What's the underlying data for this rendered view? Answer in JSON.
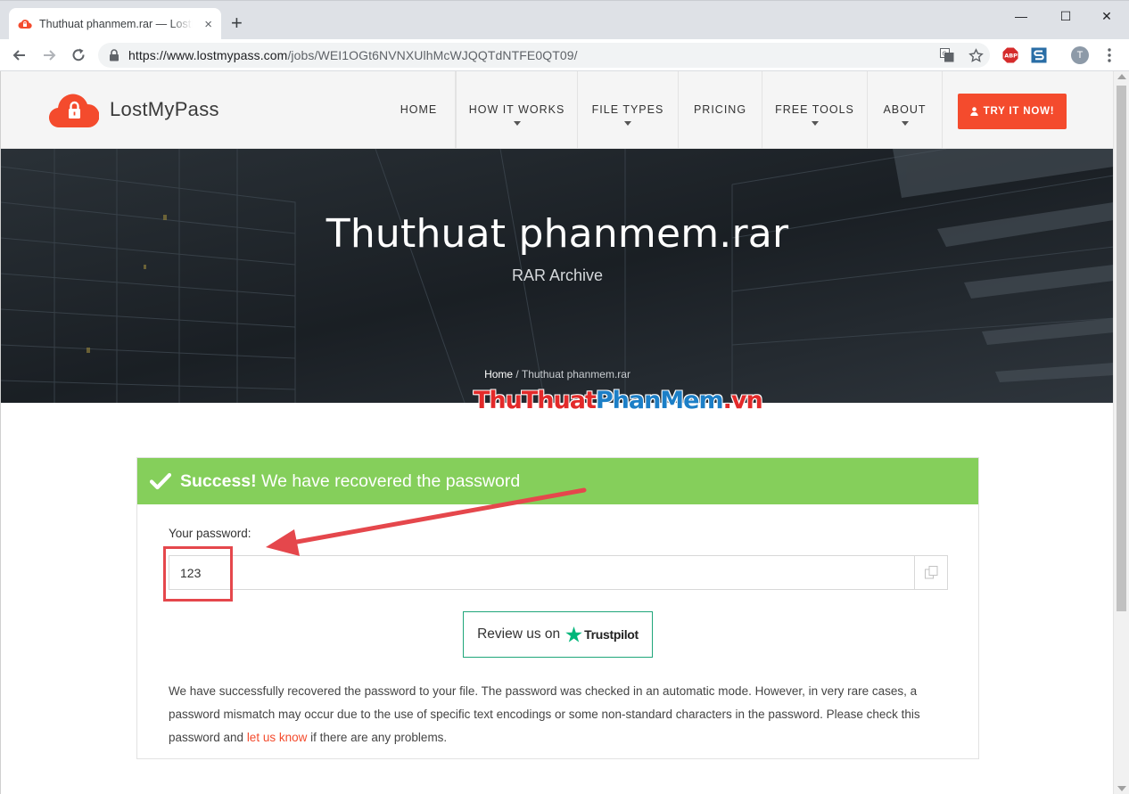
{
  "browser": {
    "tab_title": "Thuthuat phanmem.rar — LostMyPass",
    "tab_close_glyph": "×",
    "new_tab_glyph": "+",
    "url_host": "https://www.lostmypass.com",
    "url_path": "/jobs/WEI1OGt6NVNXUlhMcWJQQTdNTFE0QT09/",
    "profile_initial": "T",
    "window_controls": {
      "minimize": "—",
      "maximize": "☐",
      "close": "✕"
    },
    "icons": [
      "back-icon",
      "forward-icon",
      "reload-icon",
      "lock-icon",
      "translate-icon",
      "star-icon",
      "adblock-icon",
      "extension-icon",
      "profile-icon",
      "menu-icon"
    ]
  },
  "site": {
    "logo_text": "LostMyPass",
    "nav": [
      {
        "label": "HOME",
        "dropdown": false
      },
      {
        "label": "HOW IT WORKS",
        "dropdown": true
      },
      {
        "label": "FILE TYPES",
        "dropdown": true
      },
      {
        "label": "PRICING",
        "dropdown": false
      },
      {
        "label": "FREE TOOLS",
        "dropdown": true
      },
      {
        "label": "ABOUT",
        "dropdown": true
      }
    ],
    "cta_label": "TRY IT NOW!",
    "accent_color": "#f44b2d"
  },
  "hero": {
    "title": "Thuthuat phanmem.rar",
    "subtitle": "RAR Archive",
    "breadcrumb_home": "Home",
    "breadcrumb_sep": " / ",
    "breadcrumb_current": "Thuthuat phanmem.rar"
  },
  "watermark": {
    "part1": "ThuThuat",
    "part2": "PhanMem",
    "part3": ".vn"
  },
  "result": {
    "status_bold": "Success!",
    "status_text": " We have recovered the password",
    "status_color": "#85cf5b",
    "password_label": "Your password:",
    "password_value": "123",
    "review_label": "Review us on",
    "review_brand": "Trustpilot",
    "body_before_link": "We have successfully recovered the password to your file. The password was checked in an automatic mode. However, in very rare cases, a password mismatch may occur due to the use of specific text encodings or some non-standard characters in the password. Please check this password and ",
    "body_link": "let us know",
    "body_after_link": " if there are any problems."
  }
}
